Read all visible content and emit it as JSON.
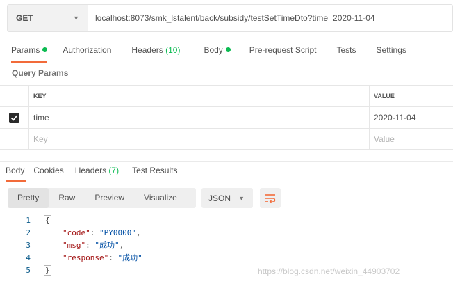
{
  "request": {
    "method": "GET",
    "url": "localhost:8073/smk_lstalent/back/subsidy/testSetTimeDto?time=2020-11-04"
  },
  "request_tabs": [
    {
      "label": "Params",
      "dot": true
    },
    {
      "label": "Authorization"
    },
    {
      "label": "Headers",
      "count": "(10)"
    },
    {
      "label": "Body",
      "dot": true
    },
    {
      "label": "Pre-request Script"
    },
    {
      "label": "Tests"
    },
    {
      "label": "Settings"
    }
  ],
  "query_params": {
    "title": "Query Params",
    "columns": [
      "KEY",
      "VALUE"
    ],
    "rows": [
      {
        "checked": true,
        "key": "time",
        "value": "2020-11-04"
      }
    ],
    "placeholder_key": "Key",
    "placeholder_value": "Value"
  },
  "response_tabs": [
    {
      "label": "Body"
    },
    {
      "label": "Cookies"
    },
    {
      "label": "Headers",
      "count": "(7)"
    },
    {
      "label": "Test Results"
    }
  ],
  "view_modes": [
    "Pretty",
    "Raw",
    "Preview",
    "Visualize"
  ],
  "format": "JSON",
  "code_lines": {
    "numbers": [
      "1",
      "2",
      "3",
      "4",
      "5"
    ],
    "open": "{",
    "code_key": "\"code\"",
    "code_val": "\"PY0000\"",
    "msg_key": "\"msg\"",
    "msg_val": "\"成功\"",
    "resp_key": "\"response\"",
    "resp_val": "\"成功\"",
    "close": "}"
  },
  "watermark": "https://blog.csdn.net/weixin_44903702",
  "colors": {
    "accent": "#f26b3a",
    "status_green": "#0cbb52"
  }
}
